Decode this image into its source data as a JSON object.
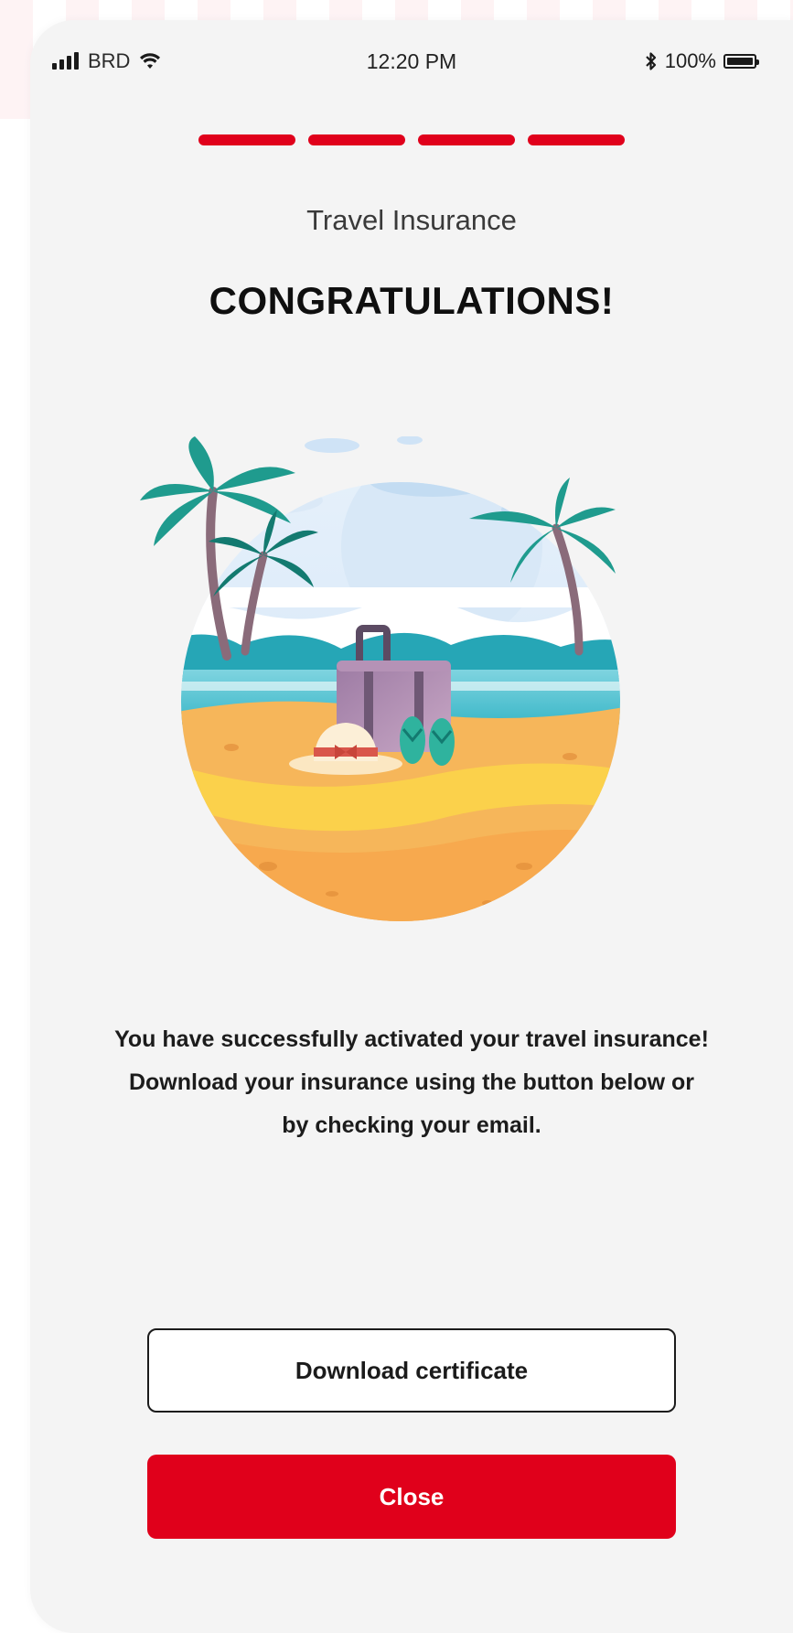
{
  "status_bar": {
    "carrier": "BRD",
    "time": "12:20 PM",
    "battery": "100%",
    "icons": [
      "signal-icon",
      "wifi-icon",
      "bluetooth-icon",
      "battery-icon"
    ]
  },
  "progress": {
    "steps_total": 4,
    "steps_completed": 4,
    "color": "#e0001b"
  },
  "header": {
    "subtitle": "Travel Insurance",
    "title": "CONGRATULATIONS!"
  },
  "illustration": {
    "subject": "beach-scene-illustration"
  },
  "message": {
    "text": "You have successfully activated your travel insurance! Download your insurance using the button below or by checking your email."
  },
  "actions": {
    "download_label": "Download certificate",
    "close_label": "Close"
  },
  "colors": {
    "accent": "#e0001b",
    "background": "#f4f4f4"
  }
}
